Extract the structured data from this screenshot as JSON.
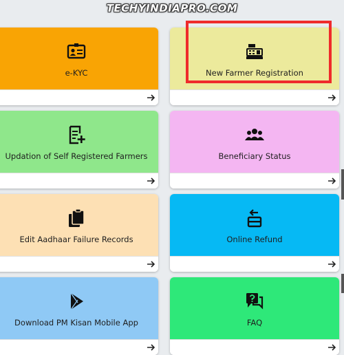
{
  "watermark": "TECHYINDIAPRO.COM",
  "colors": {
    "ekyc": "#f9a404",
    "new_farmer": "#ecea9c",
    "updation": "#8fe78b",
    "beneficiary": "#f4b6f2",
    "aadhaar": "#fde0b4",
    "refund": "#06b9f4",
    "download": "#8fc9f5",
    "faq": "#2ee879",
    "highlight": "#ef2b2b"
  },
  "cards": {
    "ekyc": {
      "label": "e-KYC",
      "icon": "id-card-icon"
    },
    "new_farmer": {
      "label": "New Farmer Registration",
      "icon": "cash-register-icon"
    },
    "updation": {
      "label": "Updation of Self Registered Farmers",
      "icon": "document-plus-icon"
    },
    "beneficiary": {
      "label": "Beneficiary Status",
      "icon": "group-icon"
    },
    "aadhaar": {
      "label": "Edit Aadhaar Failure Records",
      "icon": "clipboard-icon"
    },
    "refund": {
      "label": "Online Refund",
      "icon": "refund-box-icon"
    },
    "download": {
      "label": "Download PM Kisan Mobile App",
      "icon": "play-store-icon"
    },
    "faq": {
      "label": "FAQ",
      "icon": "question-bubble-icon"
    }
  }
}
